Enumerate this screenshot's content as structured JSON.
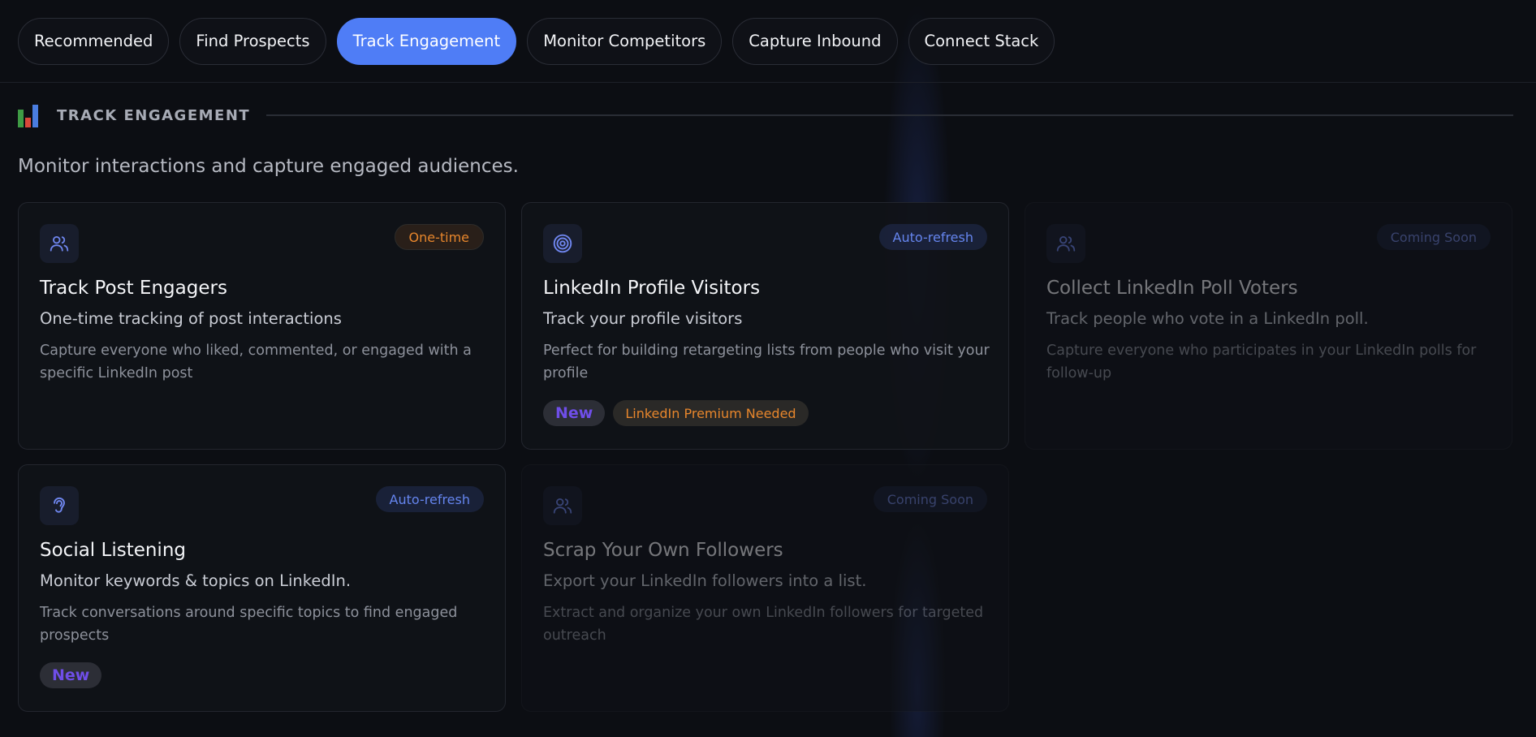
{
  "tabs": [
    {
      "label": "Recommended"
    },
    {
      "label": "Find Prospects"
    },
    {
      "label": "Track Engagement"
    },
    {
      "label": "Monitor Competitors"
    },
    {
      "label": "Capture Inbound"
    },
    {
      "label": "Connect Stack"
    }
  ],
  "active_tab": "Track Engagement",
  "section": {
    "icon": "bar-chart-icon",
    "title": "TRACK ENGAGEMENT",
    "description": "Monitor interactions and capture engaged audiences."
  },
  "colors": {
    "accent": "#4f7df6",
    "orange": "#e7862c",
    "new_purple": "#6f4ee8",
    "background": "#0c0e13"
  },
  "cards": [
    {
      "icon": "users-icon",
      "badge": "One-time",
      "title": "Track Post Engagers",
      "subtitle": "One-time tracking of post interactions",
      "description": "Capture everyone who liked, commented, or engaged with a specific LinkedIn post"
    },
    {
      "icon": "target-icon",
      "badge": "Auto-refresh",
      "title": "LinkedIn Profile Visitors",
      "subtitle": "Track your profile visitors",
      "description": "Perfect for building retargeting lists from people who visit your profile",
      "tags": [
        "New",
        "LinkedIn Premium Needed"
      ]
    },
    {
      "icon": "users-icon",
      "badge": "Coming Soon",
      "title": "Collect LinkedIn Poll Voters",
      "subtitle": "Track people who vote in a LinkedIn poll.",
      "description": "Capture everyone who participates in your LinkedIn polls for follow-up"
    },
    {
      "icon": "ear-icon",
      "badge": "Auto-refresh",
      "title": "Social Listening",
      "subtitle": "Monitor keywords & topics on LinkedIn.",
      "description": "Track conversations around specific topics to find engaged prospects",
      "tags": [
        "New"
      ]
    },
    {
      "icon": "users-icon",
      "badge": "Coming Soon",
      "title": "Scrap Your Own Followers",
      "subtitle": "Export your LinkedIn followers into a list.",
      "description": "Extract and organize your own LinkedIn followers for targeted outreach"
    }
  ]
}
